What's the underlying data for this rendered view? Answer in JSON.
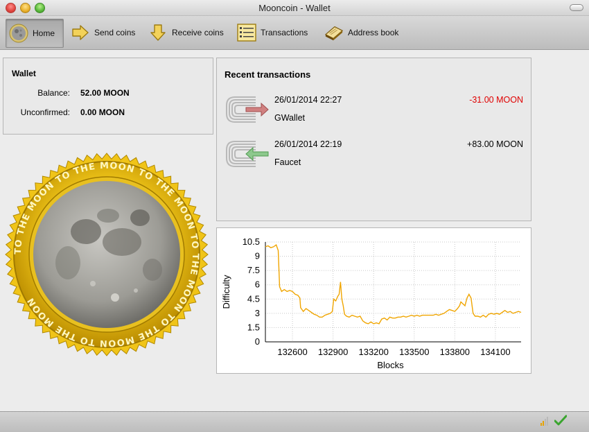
{
  "window": {
    "title": "Mooncoin - Wallet"
  },
  "toolbar": {
    "home": "Home",
    "send": "Send coins",
    "receive": "Receive coins",
    "transactions": "Transactions",
    "address_book": "Address book"
  },
  "wallet": {
    "heading": "Wallet",
    "balance_label": "Balance:",
    "balance_value": "52.00 MOON",
    "unconfirmed_label": "Unconfirmed:",
    "unconfirmed_value": "0.00 MOON"
  },
  "coin_text": "TO THE MOON TO THE MOON TO THE MOON TO THE MOON TO THE MOON TO THE MOON",
  "recent": {
    "heading": "Recent transactions",
    "items": [
      {
        "date": "26/01/2014 22:27",
        "label": "GWallet",
        "amount": "-31.00 MOON",
        "direction": "sent",
        "amount_color": "#e00000"
      },
      {
        "date": "26/01/2014 22:19",
        "label": "Faucet",
        "amount": "+83.00 MOON",
        "direction": "received",
        "amount_color": "#000000"
      }
    ]
  },
  "chart_data": {
    "type": "line",
    "title": "",
    "xlabel": "Blocks",
    "ylabel": "Difficulty",
    "xlim": [
      132400,
      134290
    ],
    "ylim": [
      0,
      10.5
    ],
    "xticks": [
      132600,
      132900,
      133200,
      133500,
      133800,
      134100
    ],
    "yticks": [
      0,
      1.5,
      3,
      4.5,
      6,
      7.5,
      9,
      10.5
    ],
    "grid": true,
    "series": [
      {
        "name": "",
        "color": "#f0a500",
        "points": [
          [
            132400,
            10.0
          ],
          [
            132420,
            10.1
          ],
          [
            132440,
            9.9
          ],
          [
            132460,
            10.0
          ],
          [
            132480,
            10.2
          ],
          [
            132495,
            9.6
          ],
          [
            132505,
            5.8
          ],
          [
            132520,
            5.3
          ],
          [
            132540,
            5.5
          ],
          [
            132560,
            5.3
          ],
          [
            132580,
            5.4
          ],
          [
            132600,
            5.3
          ],
          [
            132620,
            5.0
          ],
          [
            132640,
            4.9
          ],
          [
            132655,
            4.6
          ],
          [
            132660,
            3.6
          ],
          [
            132680,
            3.2
          ],
          [
            132700,
            3.5
          ],
          [
            132720,
            3.3
          ],
          [
            132740,
            3.1
          ],
          [
            132760,
            2.9
          ],
          [
            132780,
            2.8
          ],
          [
            132800,
            2.6
          ],
          [
            132820,
            2.6
          ],
          [
            132840,
            2.8
          ],
          [
            132860,
            2.9
          ],
          [
            132880,
            3.0
          ],
          [
            132895,
            3.2
          ],
          [
            132905,
            4.5
          ],
          [
            132920,
            4.3
          ],
          [
            132935,
            4.8
          ],
          [
            132945,
            5.0
          ],
          [
            132955,
            6.3
          ],
          [
            132965,
            4.5
          ],
          [
            132975,
            3.8
          ],
          [
            132985,
            2.9
          ],
          [
            133000,
            2.7
          ],
          [
            133020,
            2.6
          ],
          [
            133040,
            2.8
          ],
          [
            133060,
            2.7
          ],
          [
            133080,
            2.6
          ],
          [
            133100,
            2.7
          ],
          [
            133120,
            2.2
          ],
          [
            133140,
            2.0
          ],
          [
            133160,
            1.9
          ],
          [
            133180,
            2.1
          ],
          [
            133200,
            1.9
          ],
          [
            133220,
            2.0
          ],
          [
            133240,
            1.9
          ],
          [
            133260,
            2.4
          ],
          [
            133280,
            2.5
          ],
          [
            133300,
            2.3
          ],
          [
            133320,
            2.6
          ],
          [
            133340,
            2.5
          ],
          [
            133360,
            2.5
          ],
          [
            133380,
            2.6
          ],
          [
            133400,
            2.6
          ],
          [
            133420,
            2.7
          ],
          [
            133440,
            2.6
          ],
          [
            133460,
            2.7
          ],
          [
            133480,
            2.8
          ],
          [
            133500,
            2.7
          ],
          [
            133520,
            2.8
          ],
          [
            133540,
            2.7
          ],
          [
            133560,
            2.8
          ],
          [
            133580,
            2.8
          ],
          [
            133600,
            2.8
          ],
          [
            133620,
            2.8
          ],
          [
            133640,
            2.8
          ],
          [
            133660,
            2.9
          ],
          [
            133680,
            2.8
          ],
          [
            133700,
            2.9
          ],
          [
            133720,
            3.0
          ],
          [
            133740,
            3.2
          ],
          [
            133760,
            3.4
          ],
          [
            133780,
            3.3
          ],
          [
            133800,
            3.2
          ],
          [
            133820,
            3.5
          ],
          [
            133835,
            3.8
          ],
          [
            133845,
            4.2
          ],
          [
            133860,
            4.0
          ],
          [
            133875,
            3.8
          ],
          [
            133890,
            4.6
          ],
          [
            133905,
            5.0
          ],
          [
            133920,
            4.6
          ],
          [
            133935,
            3.0
          ],
          [
            133950,
            2.7
          ],
          [
            133970,
            2.7
          ],
          [
            133990,
            2.6
          ],
          [
            134010,
            2.8
          ],
          [
            134030,
            2.6
          ],
          [
            134050,
            2.9
          ],
          [
            134070,
            3.0
          ],
          [
            134090,
            2.9
          ],
          [
            134110,
            3.0
          ],
          [
            134130,
            2.9
          ],
          [
            134150,
            3.1
          ],
          [
            134170,
            3.3
          ],
          [
            134190,
            3.1
          ],
          [
            134210,
            3.2
          ],
          [
            134230,
            3.0
          ],
          [
            134250,
            3.1
          ],
          [
            134270,
            3.2
          ],
          [
            134290,
            3.1
          ]
        ]
      }
    ]
  }
}
